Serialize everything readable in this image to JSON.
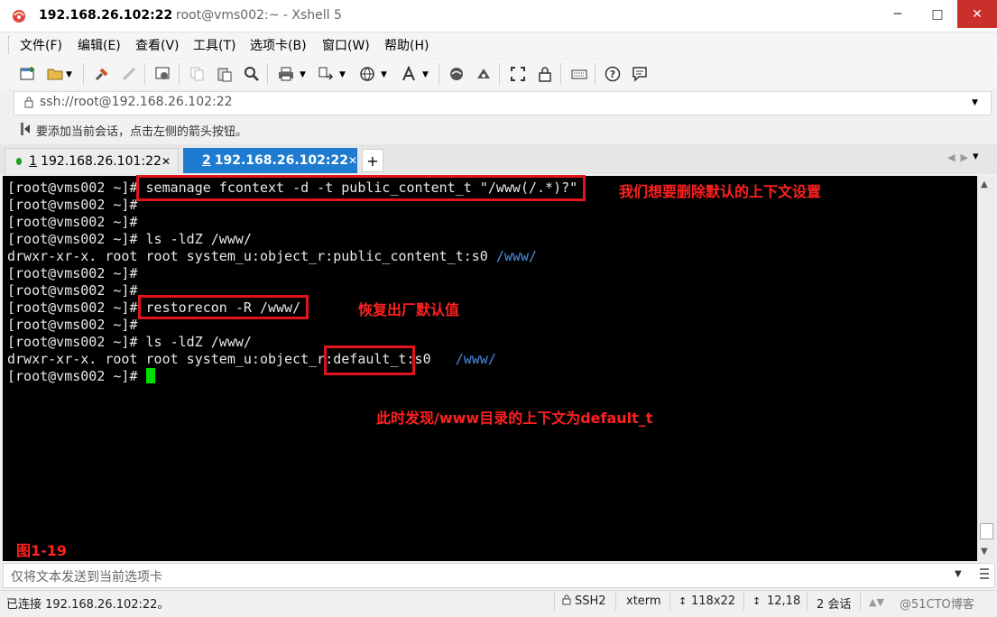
{
  "window": {
    "title_host": "192.168.26.102:22",
    "title_rest": "root@vms002:~ - Xshell 5",
    "controls": {
      "minimize": "─",
      "maximize": "□",
      "close": "✕"
    }
  },
  "menu": [
    "文件(F)",
    "编辑(E)",
    "查看(V)",
    "工具(T)",
    "选项卡(B)",
    "窗口(W)",
    "帮助(H)"
  ],
  "toolbar": {
    "icons": [
      "new-session-icon",
      "open-folder-icon",
      "reconnect-icon",
      "disconnect-icon",
      "properties-icon",
      "copy-icon",
      "paste-icon",
      "find-icon",
      "print-icon",
      "transfer-icon",
      "globe-icon",
      "font-icon",
      "xftp-icon",
      "xmanager-icon",
      "fullscreen-icon",
      "lock-icon",
      "keyboard-icon",
      "help-icon",
      "chat-icon"
    ]
  },
  "address": {
    "value": "ssh://root@192.168.26.102:22"
  },
  "hint": {
    "text": "要添加当前会话，点击左侧的箭头按钮。"
  },
  "tabs": [
    {
      "num": "1",
      "label": "192.168.26.101:22",
      "active": false
    },
    {
      "num": "2",
      "label": "192.168.26.102:22",
      "active": true
    }
  ],
  "tab_add": "+",
  "terminal": {
    "lines": [
      {
        "prompt": "[root@vms002 ~]#",
        "cmd": " semanage fcontext -d -t public_content_t \"/www(/.*)?\""
      },
      {
        "prompt": "[root@vms002 ~]#",
        "cmd": ""
      },
      {
        "prompt": "[root@vms002 ~]#",
        "cmd": ""
      },
      {
        "prompt": "[root@vms002 ~]#",
        "cmd": " ls -ldZ /www/"
      },
      {
        "output": "drwxr-xr-x. root root system_u:object_r:public_content_t:s0 ",
        "highlight": "/www/"
      },
      {
        "prompt": "[root@vms002 ~]#",
        "cmd": ""
      },
      {
        "prompt": "[root@vms002 ~]#",
        "cmd": ""
      },
      {
        "prompt": "[root@vms002 ~]#",
        "cmd": " restorecon -R /www/"
      },
      {
        "prompt": "[root@vms002 ~]#",
        "cmd": ""
      },
      {
        "prompt": "[root@vms002 ~]#",
        "cmd": " ls -ldZ /www/"
      },
      {
        "output": "drwxr-xr-x. root root system_u:object_r:default_t:s0   ",
        "highlight": "/www/"
      },
      {
        "prompt": "[root@vms002 ~]#",
        "cmd": " ",
        "cursor": true
      }
    ],
    "annotations": {
      "a1": "我们想要删除默认的上下文设置",
      "a2": "恢复出厂默认值",
      "a3": "此时发现/www目录的上下文为default_t",
      "figure": "图1-19"
    },
    "cursor_color": "#00e000",
    "annotation_color": "#ff2020"
  },
  "compose": {
    "placeholder": "仅将文本发送到当前选项卡"
  },
  "status": {
    "connection": "已连接 192.168.26.102:22。",
    "protocol": "SSH2",
    "terminal_type": "xterm",
    "size": "118x22",
    "cursor_pos": "12,18",
    "sessions": "2 会话",
    "watermark": "@51CTO博客"
  },
  "colors": {
    "active_tab": "#1e7bd0",
    "close_button": "#c9302c",
    "highlight_box": "#e0141d",
    "link_blue": "#4b8bea"
  }
}
